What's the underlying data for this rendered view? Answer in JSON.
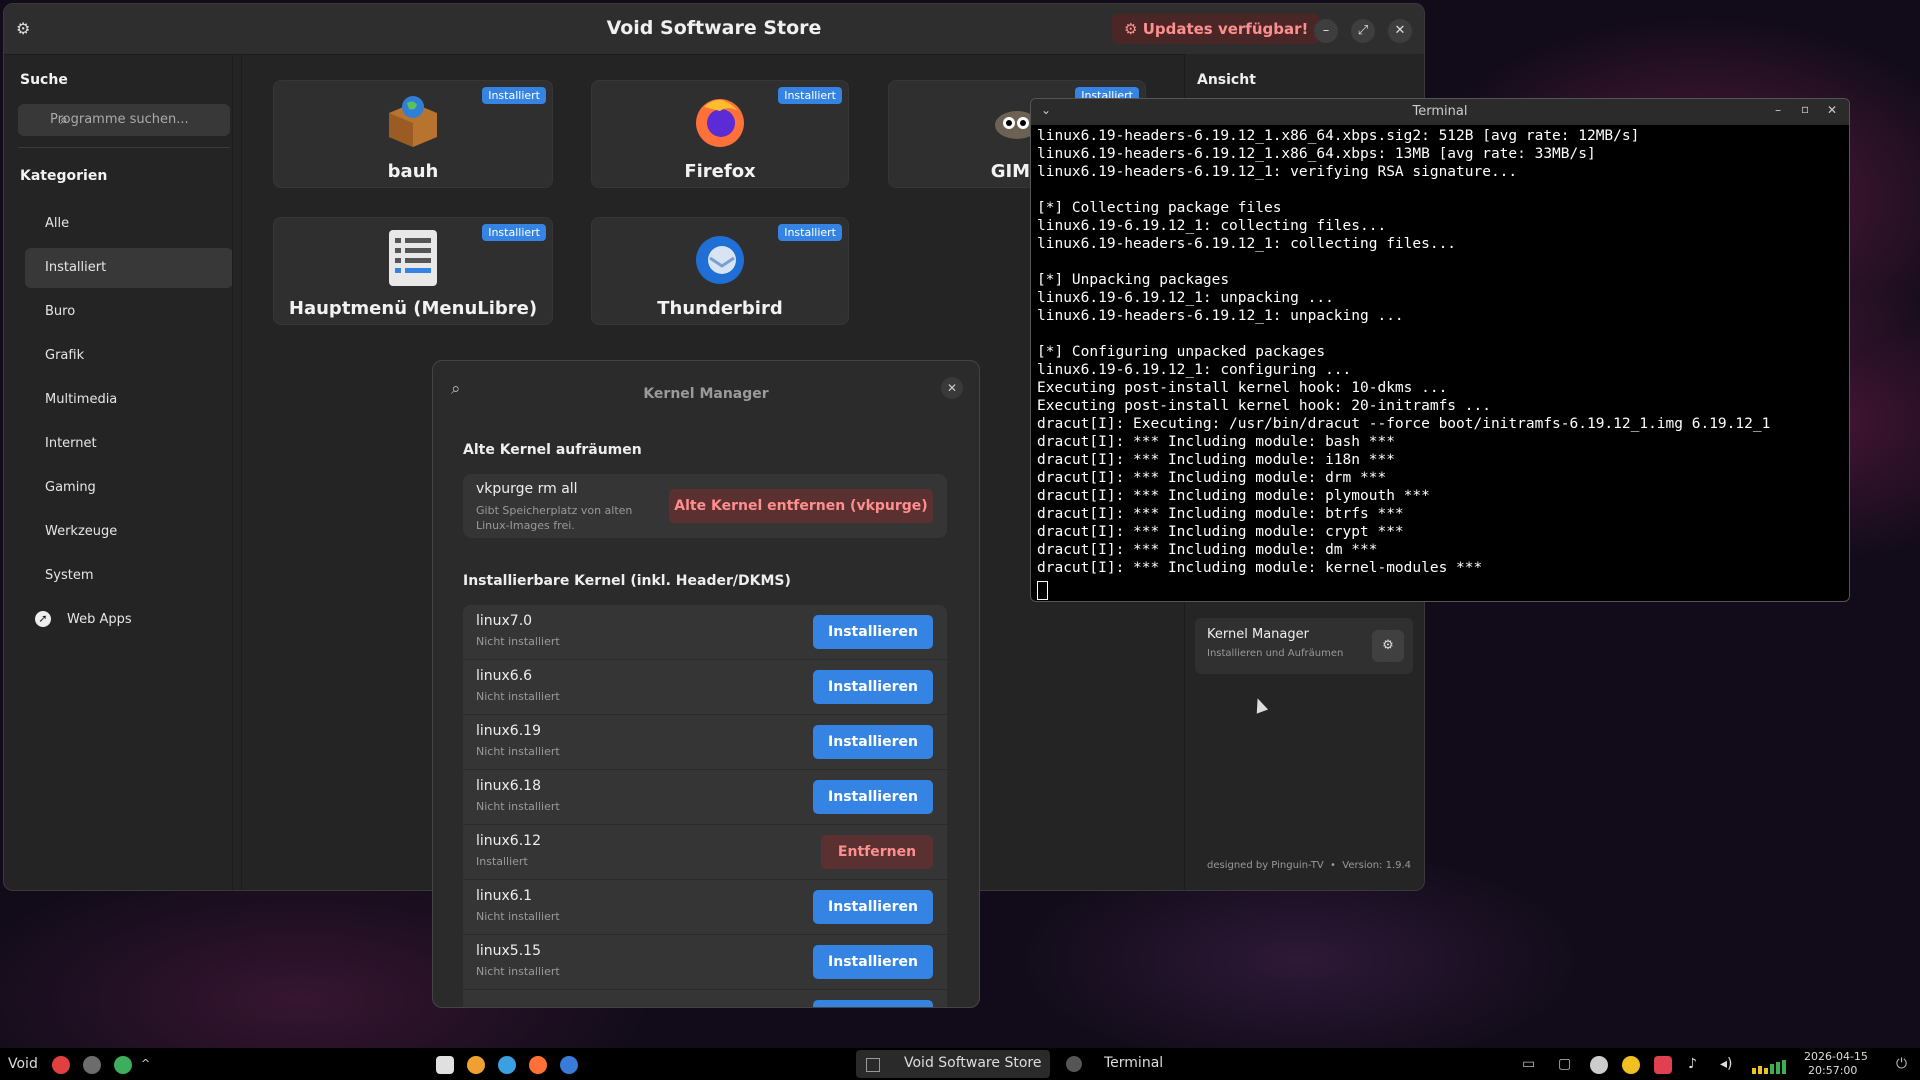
{
  "store": {
    "title": "Void Software Store",
    "updates_label": "Updates verfügbar!",
    "minimize": "–",
    "maximize": "⤢",
    "close": "✕",
    "search_heading": "Suche",
    "search_placeholder": "Programme suchen...",
    "categories_heading": "Kategorien",
    "categories": [
      "Alle",
      "Installiert",
      "Buro",
      "Grafik",
      "Multimedia",
      "Internet",
      "Gaming",
      "Werkzeuge",
      "System",
      "Web Apps"
    ],
    "active_category": "Installiert",
    "apps": [
      {
        "name": "bauh",
        "badge": "Installiert"
      },
      {
        "name": "Firefox",
        "badge": "Installiert"
      },
      {
        "name": "GIMP",
        "badge": "Installiert"
      },
      {
        "name": "Hauptmenü (MenuLibre)",
        "badge": "Installiert"
      },
      {
        "name": "Thunderbird",
        "badge": "Installiert"
      }
    ],
    "right_panel": {
      "heading": "Ansicht",
      "kernel_card_title": "Kernel Manager",
      "kernel_card_sub": "Installieren und Aufräumen",
      "footer": "designed by Pinguin-TV  •  Version: 1.9.4"
    }
  },
  "kernel_manager": {
    "title": "Kernel Manager",
    "cleanup_heading": "Alte Kernel aufräumen",
    "cleanup_cmd": "vkpurge rm all",
    "cleanup_desc_1": "Gibt Speicherplatz von alten",
    "cleanup_desc_2": "Linux-Images frei.",
    "cleanup_button": "Alte Kernel entfernen (vkpurge)",
    "installable_heading": "Installierbare Kernel (inkl. Header/DKMS)",
    "kernels": [
      {
        "name": "linux7.0",
        "status": "Nicht installiert",
        "action": "Installieren"
      },
      {
        "name": "linux6.6",
        "status": "Nicht installiert",
        "action": "Installieren"
      },
      {
        "name": "linux6.19",
        "status": "Nicht installiert",
        "action": "Installieren"
      },
      {
        "name": "linux6.18",
        "status": "Nicht installiert",
        "action": "Installieren"
      },
      {
        "name": "linux6.12",
        "status": "Installiert",
        "action": "Entfernen"
      },
      {
        "name": "linux6.1",
        "status": "Nicht installiert",
        "action": "Installieren"
      },
      {
        "name": "linux5.15",
        "status": "Nicht installiert",
        "action": "Installieren"
      }
    ]
  },
  "terminal": {
    "title": "Terminal",
    "lines": [
      "linux6.19-headers-6.19.12_1.x86_64.xbps.sig2: 512B [avg rate: 12MB/s]",
      "linux6.19-headers-6.19.12_1.x86_64.xbps: 13MB [avg rate: 33MB/s]",
      "linux6.19-headers-6.19.12_1: verifying RSA signature...",
      "",
      "[*] Collecting package files",
      "linux6.19-6.19.12_1: collecting files...",
      "linux6.19-headers-6.19.12_1: collecting files...",
      "",
      "[*] Unpacking packages",
      "linux6.19-6.19.12_1: unpacking ...",
      "linux6.19-headers-6.19.12_1: unpacking ...",
      "",
      "[*] Configuring unpacked packages",
      "linux6.19-6.19.12_1: configuring ...",
      "Executing post-install kernel hook: 10-dkms ...",
      "Executing post-install kernel hook: 20-initramfs ...",
      "dracut[I]: Executing: /usr/bin/dracut --force boot/initramfs-6.19.12_1.img 6.19.12_1",
      "dracut[I]: *** Including module: bash ***",
      "dracut[I]: *** Including module: i18n ***",
      "dracut[I]: *** Including module: drm ***",
      "dracut[I]: *** Including module: plymouth ***",
      "dracut[I]: *** Including module: btrfs ***",
      "dracut[I]: *** Including module: crypt ***",
      "dracut[I]: *** Including module: dm ***",
      "dracut[I]: *** Including module: kernel-modules ***"
    ]
  },
  "taskbar": {
    "start_label": "Void",
    "window_store": "Void Software Store",
    "window_terminal": "Terminal",
    "date": "2026-04-15",
    "time": "20:57:00"
  }
}
